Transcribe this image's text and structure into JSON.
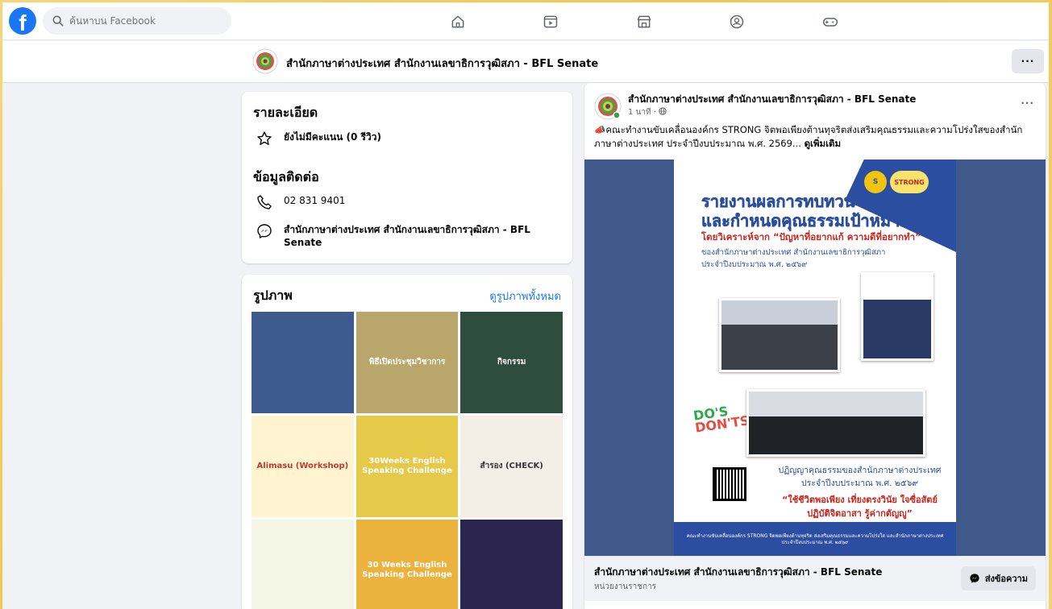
{
  "topbar": {
    "logo": "f",
    "search_placeholder": "ค้นหาบน Facebook",
    "nav_icons": [
      "home-icon",
      "video-icon",
      "marketplace-icon",
      "groups-icon",
      "gaming-icon"
    ]
  },
  "page": {
    "name": "สำนักภาษาต่างประเทศ สำนักงานเลขาธิการวุฒิสภา - BFL Senate",
    "more": "···"
  },
  "details": {
    "title": "รายละเอียด",
    "rating": "ยังไม่มีคะแนน (0 รีวิว)",
    "contact_title": "ข้อมูลติดต่อ",
    "phone": "02 831 9401",
    "messenger": "สำนักภาษาต่างประเทศ สำนักงานเลขาธิการวุฒิสภา - BFL Senate"
  },
  "photos": {
    "title": "รูปภาพ",
    "see_all": "ดูรูปภาพทั้งหมด"
  },
  "post": {
    "author": "สำนักภาษาต่างประเทศ สำนักงานเลขาธิการวุฒิสภา - BFL Senate",
    "time": "1 นาที · ",
    "text": "📣คณะทำงานขับเคลื่อนองค์กร STRONG จิตพอเพียงต้านทุจริตส่งเสริมคุณธรรมและความโปร่งใสของสำนักภาษาต่างประเทศ ประจำปีงบประมาณ พ.ศ. 2569... ",
    "see_more": "ดูเพิ่มเติม",
    "poster": {
      "title_line1": "รายงานผลการทบทวน",
      "title_line2": "และกำหนดคุณธรรมเป้าหมาย",
      "subtitle": "โดยวิเคราะห์จาก “ปัญหาที่อยากแก้ ความดีที่อยากทำ”",
      "org_line1": "ของสำนักภาษาต่างประเทศ สำนักงานเลขาธิการวุฒิสภา",
      "org_line2": "ประจำปีงบประมาณ พ.ศ. ๒๕๖๙",
      "dos": "DO'S",
      "donts": "DON'TS",
      "declaration_line1": "ปฏิญญาคุณธรรมของสำนักภาษาต่างประเทศ",
      "declaration_line2": "ประจำปีงบประมาณ พ.ศ. ๒๕๖๙",
      "motto_line1": "“ใช้ชีวิตพอเพียง เที่ยงตรงวินัย ใจซื่อสัตย์",
      "motto_line2": "ปฏิบัติจิตอาสา รู้ค่ากตัญญู”",
      "footer": "คณะทำงานขับเคลื่อนองค์กร STRONG จิตพอเพียงต้านทุจริต ส่งเสริมคุณธรรมและความโปร่งใส และสำนักภาษาต่างประเทศ ประจำปีงบประมาณ พ.ศ. ๒๕๖๙",
      "badges": [
        "S",
        "STRONG"
      ]
    },
    "footer_title": "สำนักภาษาต่างประเทศ สำนักงานเลขาธิการวุฒิสภา - BFL Senate",
    "footer_sub": "หน่วยงานราชการ",
    "message_btn": "ส่งข้อความ"
  },
  "thumbs": [
    {
      "label": "",
      "bg": "#3d5b8f",
      "fg": "#ffffff"
    },
    {
      "label": "พิธีเปิดประชุมวิชาการ",
      "bg": "#b9a66a",
      "fg": "#ffffff"
    },
    {
      "label": "กิจกรรม",
      "bg": "#2e4d3f",
      "fg": "#ffffff"
    },
    {
      "label": "Alimasu (Workshop)",
      "bg": "#fff4cf",
      "fg": "#c0392b"
    },
    {
      "label": "30Weeks English Speaking Challenge",
      "bg": "#e6c948",
      "fg": "#ffffff"
    },
    {
      "label": "สำรอง (CHECK)",
      "bg": "#f4efe6",
      "fg": "#333333"
    },
    {
      "label": "",
      "bg": "#f3f6e4",
      "fg": "#3a3a3a"
    },
    {
      "label": "30 Weeks English Speaking Challenge",
      "bg": "#ecb23e",
      "fg": "#ffffff"
    },
    {
      "label": "",
      "bg": "#2b2550",
      "fg": "#ffffff"
    }
  ]
}
